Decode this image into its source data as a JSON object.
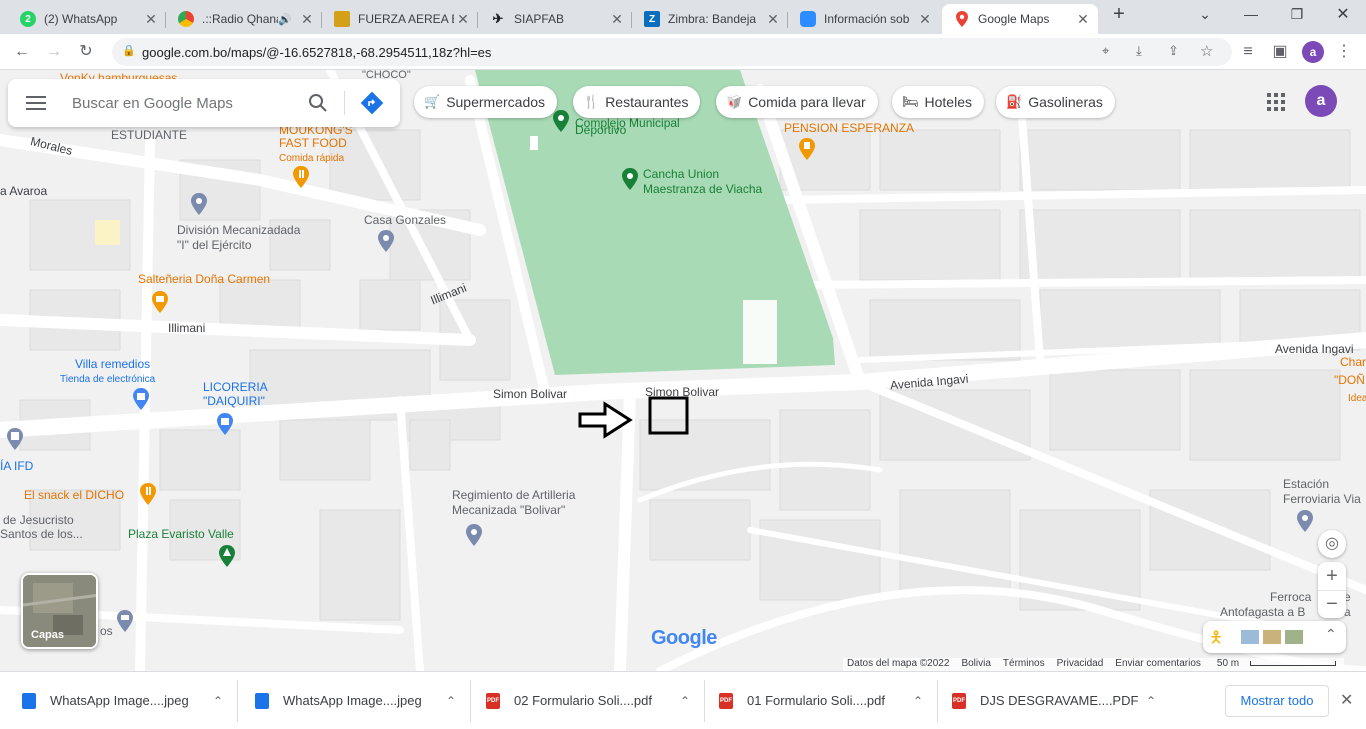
{
  "tabs": [
    {
      "title": "(2) WhatsApp",
      "icon": "whatsapp-icon",
      "badge": "2"
    },
    {
      "title": ".::Radio Qhana",
      "icon": "chrome-radio-icon"
    },
    {
      "title": "FUERZA AEREA B",
      "icon": "fab-emblem-icon"
    },
    {
      "title": "SIAPFAB",
      "icon": "airplane-icon"
    },
    {
      "title": "Zimbra: Bandeja",
      "icon": "zimbra-icon",
      "letter": "Z"
    },
    {
      "title": "Información sob",
      "icon": "zoom-icon"
    },
    {
      "title": "Google Maps",
      "icon": "google-maps-icon"
    }
  ],
  "browser": {
    "url": "google.com.bo/maps/@-16.6527818,-68.2954511,18z?hl=es",
    "profile_letter": "a"
  },
  "search": {
    "placeholder": "Buscar en Google Maps"
  },
  "chips": [
    {
      "label": "Supermercados",
      "icon": "cart-icon"
    },
    {
      "label": "Restaurantes",
      "icon": "cutlery-icon"
    },
    {
      "label": "Comida para llevar",
      "icon": "takeout-icon"
    },
    {
      "label": "Hoteles",
      "icon": "bed-icon"
    },
    {
      "label": "Gasolineras",
      "icon": "fuel-icon"
    }
  ],
  "account_letter": "a",
  "map_labels": {
    "vonky": "VonKy hamburguesas",
    "choco": "\"CHOCO\"",
    "estudiante": "ESTUDIANTE",
    "morales": "Morales",
    "avaroa": "a Avaroa",
    "moukong1": "MOUKONG'S",
    "moukong2": "FAST FOOD",
    "comida_rapida": "Comida rápida",
    "complejo1": "Complejo Municipal",
    "complejo2": "Deportivo",
    "cancha1": "Cancha Union",
    "cancha2": "Maestranza de Viacha",
    "pension": "PENSION ESPERANZA",
    "division1": "División Mecanizadada",
    "division2": "\"I\" del Ejército",
    "casa_gonzales": "Casa Gonzales",
    "saltenaria": "Salteñeria Doña Carmen",
    "illimani_a": "Illimani",
    "illimani_b": "Illimani",
    "villa1": "Villa remedios",
    "villa2": "Tienda de electrónica",
    "licoreria1": "LICORERIA",
    "licoreria2": "\"DAIQUIRI\"",
    "simon1": "Simon Bolivar",
    "simon2": "Simon Bolivar",
    "avenida1": "Avenida Ingavi",
    "avenida2": "Avenida Ingavi",
    "char1": "Char",
    "char2": "\"DOÑ",
    "char3": "Idea",
    "ifd": "ÍA IFD",
    "snack": "El snack el DICHO",
    "jesucristo1": "de Jesucristo",
    "jesucristo2": "Santos de los...",
    "regimiento1": "Regimiento de Artilleria",
    "regimiento2": "Mecanizada \"Bolivar\"",
    "plaza": "Plaza Evaristo Valle",
    "estacion1": "Estación",
    "estacion2": "Ferroviaria Via",
    "ferroca1": "Ferroca",
    "ferroca2": "Antofagasta a B",
    "ferroca3": "e",
    "ferroca4": "a",
    "os": "os"
  },
  "layers_label": "Capas",
  "google_logo": "Google",
  "footer": [
    "Datos del mapa ©2022",
    "Bolivia",
    "Términos",
    "Privacidad",
    "Enviar comentarios"
  ],
  "scale": "50 m",
  "downloads": [
    {
      "name": "WhatsApp Image....jpeg",
      "type": "image"
    },
    {
      "name": "WhatsApp Image....jpeg",
      "type": "image"
    },
    {
      "name": "02 Formulario Soli....pdf",
      "type": "pdf"
    },
    {
      "name": "01 Formulario Soli....pdf",
      "type": "pdf"
    },
    {
      "name": "DJS DESGRAVAME....PDF",
      "type": "pdf"
    }
  ],
  "show_all": "Mostrar todo",
  "colors": {
    "park": "#a8dab5",
    "accent": "#1a73e8",
    "poi_orange": "#e37400",
    "avatar": "#7b4ab7"
  }
}
